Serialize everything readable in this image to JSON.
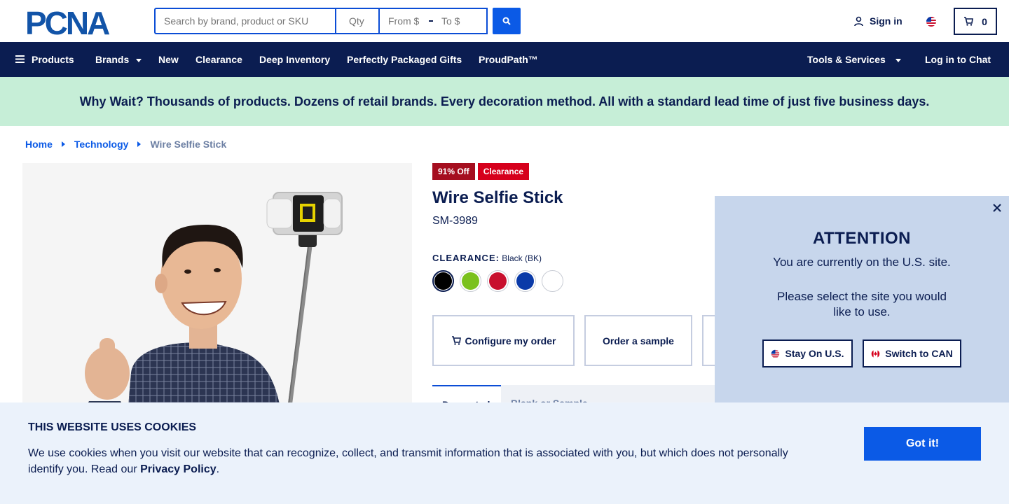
{
  "header": {
    "logo_text": "PCNA",
    "search_placeholder": "Search by brand, product or SKU",
    "qty_placeholder": "Qty",
    "from_placeholder": "From $",
    "to_placeholder": "To $",
    "signin_label": "Sign in",
    "cart_count": "0"
  },
  "nav": {
    "products": "Products",
    "brands": "Brands",
    "new": "New",
    "clearance": "Clearance",
    "deep_inventory": "Deep Inventory",
    "gifts": "Perfectly Packaged Gifts",
    "proudpath": "ProudPath™",
    "tools": "Tools & Services",
    "chat": "Log in to Chat"
  },
  "promo": "Why Wait? Thousands of products. Dozens of retail brands. Every decoration method. All with a standard lead time of just five business days.",
  "breadcrumb": {
    "home": "Home",
    "category": "Technology",
    "current": "Wire Selfie Stick"
  },
  "product": {
    "discount_badge": "91% Off",
    "clearance_badge": "Clearance",
    "title": "Wire Selfie Stick",
    "sku": "SM-3989",
    "color_label": "CLEARANCE:",
    "color_value": "Black (BK)",
    "swatches": [
      "#000000",
      "#7bc11e",
      "#c8102e",
      "#0a3aa8",
      "#ffffff"
    ],
    "configure_label": "Configure my order",
    "sample_label": "Order a sample",
    "tab_active": "Decorated",
    "tab_inactive": "Blank or Sample"
  },
  "attention": {
    "title": "ATTENTION",
    "line1": "You are currently on the U.S. site.",
    "line2": "Please select the site you would like to use.",
    "stay_label": "Stay On U.S.",
    "switch_label": "Switch to CAN"
  },
  "cookie": {
    "title": "THIS WEBSITE USES COOKIES",
    "text": "We use cookies when you visit our website that can recognize, collect, and transmit information that is associated with you, but which does not personally identify you. Read our",
    "link": "Privacy Policy",
    "period": ".",
    "button": "Got it!"
  },
  "colors": {
    "navy": "#0b1d51",
    "brand_blue": "#0b5ae6",
    "promo_green": "#c6eed7",
    "clearance_red": "#d6001c"
  }
}
